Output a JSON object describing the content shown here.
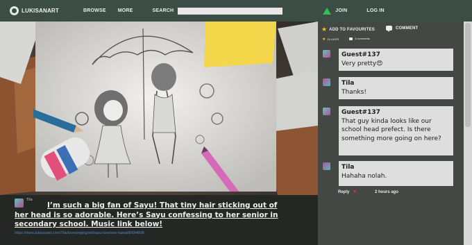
{
  "nav": {
    "logo": "LUKISANART",
    "browse": "BROWSE",
    "more": "MORE",
    "search": "SEARCH",
    "join": "JOIN",
    "login": "LOG IN"
  },
  "post": {
    "username": "Tila",
    "caption": "I’m such a big fan of Sayu! That tiny hair sticking out of her head is so adorable. Here’s Sayu confessing to her senior in secondary school. Music link below!",
    "link": "https://www.lukisanart.com/Tila/lovesinging/art/sayu-lovelove-kawaii8X94808"
  },
  "actions": {
    "favourite": "ADD TO FAVOURITES",
    "comment": "COMMENT",
    "likes": "24 LIKES",
    "comments": "4 comments"
  },
  "comments": [
    {
      "user": "Guest#137",
      "text": "Very pretty😍",
      "avatar": "#c04d9a"
    },
    {
      "user": "Tila",
      "text": "Thanks!",
      "avatar": "#4dbcc0"
    },
    {
      "user": "Guest#137",
      "text": "That guy kinda looks like our school head prefect. Is there something more going on here?",
      "avatar": "#c04d9a"
    },
    {
      "user": "Tila",
      "text": "Hahaha nolah.",
      "avatar": "#4dbcc0"
    }
  ],
  "reply": {
    "label": "Reply",
    "time": "2 hours ago"
  },
  "colors": {
    "nav": "#3b4d44",
    "join": "#2fbf52",
    "link": "#4f83c7",
    "star": "#f2c318"
  }
}
